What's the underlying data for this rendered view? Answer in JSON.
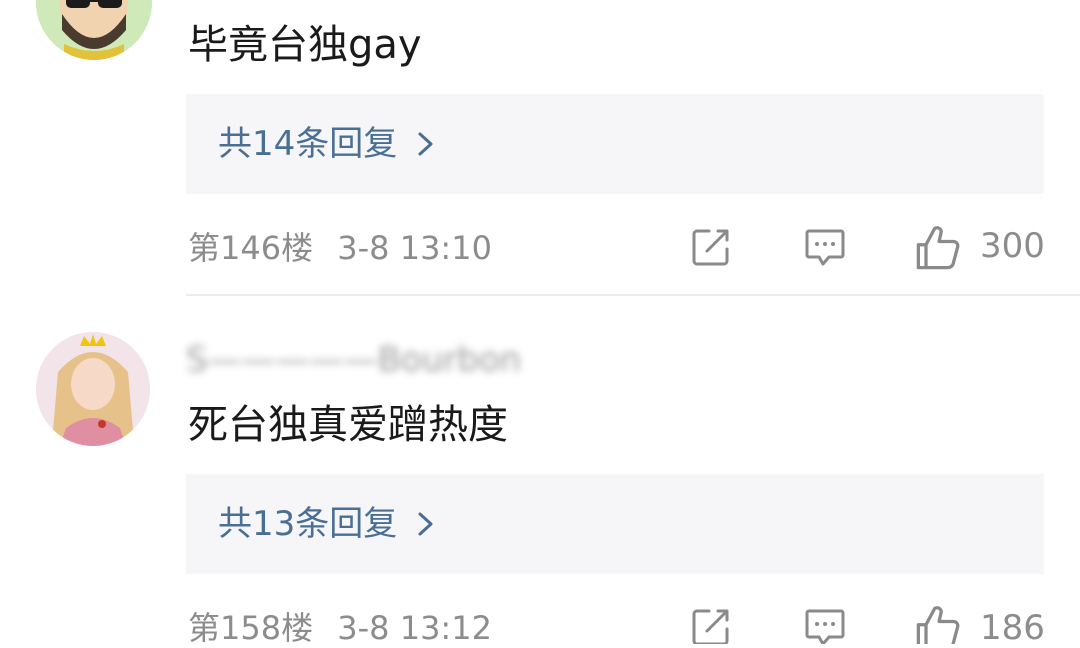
{
  "comments": [
    {
      "avatar_icon": "bearded-sunglasses-avatar",
      "text": "毕竟台独gay",
      "reply_link": "共14条回复",
      "floor": "第146楼",
      "time": "3-8 13:10",
      "likes": "300"
    },
    {
      "username": "S—————Bourbon",
      "avatar_icon": "girl-with-crown-avatar",
      "text": "死台独真爱蹭热度",
      "reply_link": "共13条回复",
      "floor": "第158楼",
      "time": "3-8 13:12",
      "likes": "186"
    }
  ],
  "colors": {
    "reply_link": "#4a6f95",
    "reply_box_bg": "#f6f6f8",
    "meta_text": "#8c8c8c",
    "icon_stroke": "#8a8a8a"
  },
  "icons": [
    "edit-icon",
    "comment-icon",
    "like-icon",
    "chevron-right-icon"
  ]
}
